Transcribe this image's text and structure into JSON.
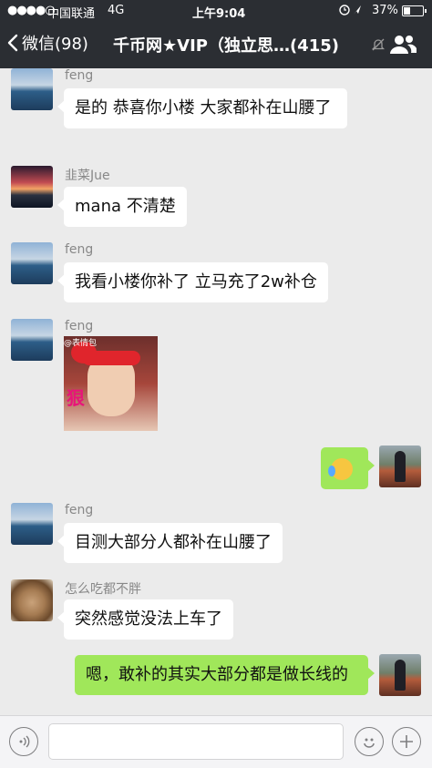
{
  "status_bar": {
    "signal": "●●●●○",
    "carrier": "中国联通",
    "network": "4G",
    "time": "上午9:04",
    "battery_percent": "37%",
    "battery_level": 0.37
  },
  "nav": {
    "back_label": "微信(98)",
    "title": "千币网★VIP（独立思…(415)"
  },
  "messages": [
    {
      "sender": "feng",
      "text": "是的 恭喜你小楼 大家都补在山腰了"
    },
    {
      "sender": "韭菜Jue",
      "text": "mana 不清楚"
    },
    {
      "sender": "feng",
      "text": "我看小楼你补了 立马充了2w补仓"
    },
    {
      "sender": "feng",
      "type": "sticker",
      "sticker_text": "狠",
      "watermark": "@表情包"
    },
    {
      "sender": "me",
      "type": "emoji",
      "emoji": "tears-of-joy-icon"
    },
    {
      "sender": "feng",
      "text": "目测大部分人都补在山腰了"
    },
    {
      "sender": "怎么吃都不胖",
      "text": "突然感觉没法上车了"
    },
    {
      "sender": "me",
      "text": "嗯，敢补的其实大部分都是做长线的"
    }
  ],
  "colors": {
    "header_bg": "#2b2e33",
    "chat_bg": "#ebebeb",
    "outgoing_bubble": "#a0e75a",
    "incoming_bubble": "#ffffff"
  }
}
